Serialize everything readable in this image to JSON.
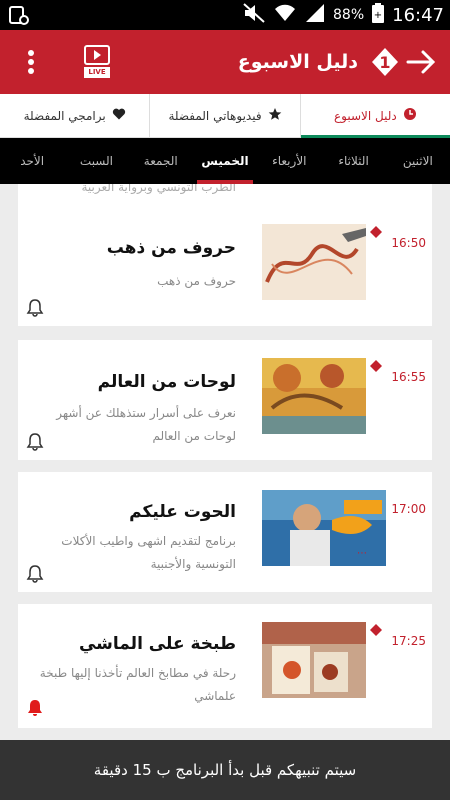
{
  "status_bar": {
    "battery": "88%",
    "time": "16:47"
  },
  "header": {
    "title": "دليل الاسبوع",
    "live_badge": "LIVE"
  },
  "top_tabs": [
    {
      "label": "دليل الاسبوع",
      "icon": "clock-icon"
    },
    {
      "label": "فيديوهاتي المفضلة",
      "icon": "star-icon"
    },
    {
      "label": "برامجي المفضلة",
      "icon": "heart-icon"
    }
  ],
  "day_tabs": [
    {
      "label": "الاثنين"
    },
    {
      "label": "الثلاثاء"
    },
    {
      "label": "الأربعاء"
    },
    {
      "label": "الخميس"
    },
    {
      "label": "الجمعة"
    },
    {
      "label": "السبت"
    },
    {
      "label": "الأحد"
    }
  ],
  "partial_item": {
    "desc": "الطرب التونسي وبرواية العربية"
  },
  "programs": [
    {
      "time": "16:50",
      "title": "حروف من ذهب",
      "desc": "حروف من ذهب",
      "bell_active": false
    },
    {
      "time": "16:55",
      "title": "لوحات من العالم",
      "desc": "نعرف على أسرار ستذهلك عن أشهر لوحات من العالم",
      "bell_active": false
    },
    {
      "time": "17:00",
      "title": "الحوت عليكم",
      "desc": "برنامج لتقديم اشهى واطيب الأكلات التونسية والأجنبية",
      "bell_active": false
    },
    {
      "time": "17:25",
      "title": "طبخة على الماشي",
      "desc": "رحلة في مطابخ العالم تأخذنا إليها طبخة علماشي",
      "bell_active": true
    }
  ],
  "toast": {
    "message": "سيتم تنبيهكم قبل بدأ البرنامج ب 15 دقيقة"
  },
  "colors": {
    "brand_red": "#c2212d",
    "active_underline": "#0d8a5b"
  }
}
